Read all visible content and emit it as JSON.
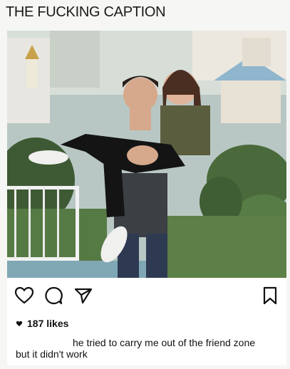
{
  "meme": {
    "title": "THE FUCKING CAPTION"
  },
  "post": {
    "image_alt": "photo",
    "actions": [
      "heart-icon",
      "comment-icon",
      "share-icon",
      "bookmark-icon"
    ],
    "likes": "187 likes",
    "caption_line1": "he tried to carry me out of the friend zone",
    "caption_line2": "but it didn't work"
  }
}
